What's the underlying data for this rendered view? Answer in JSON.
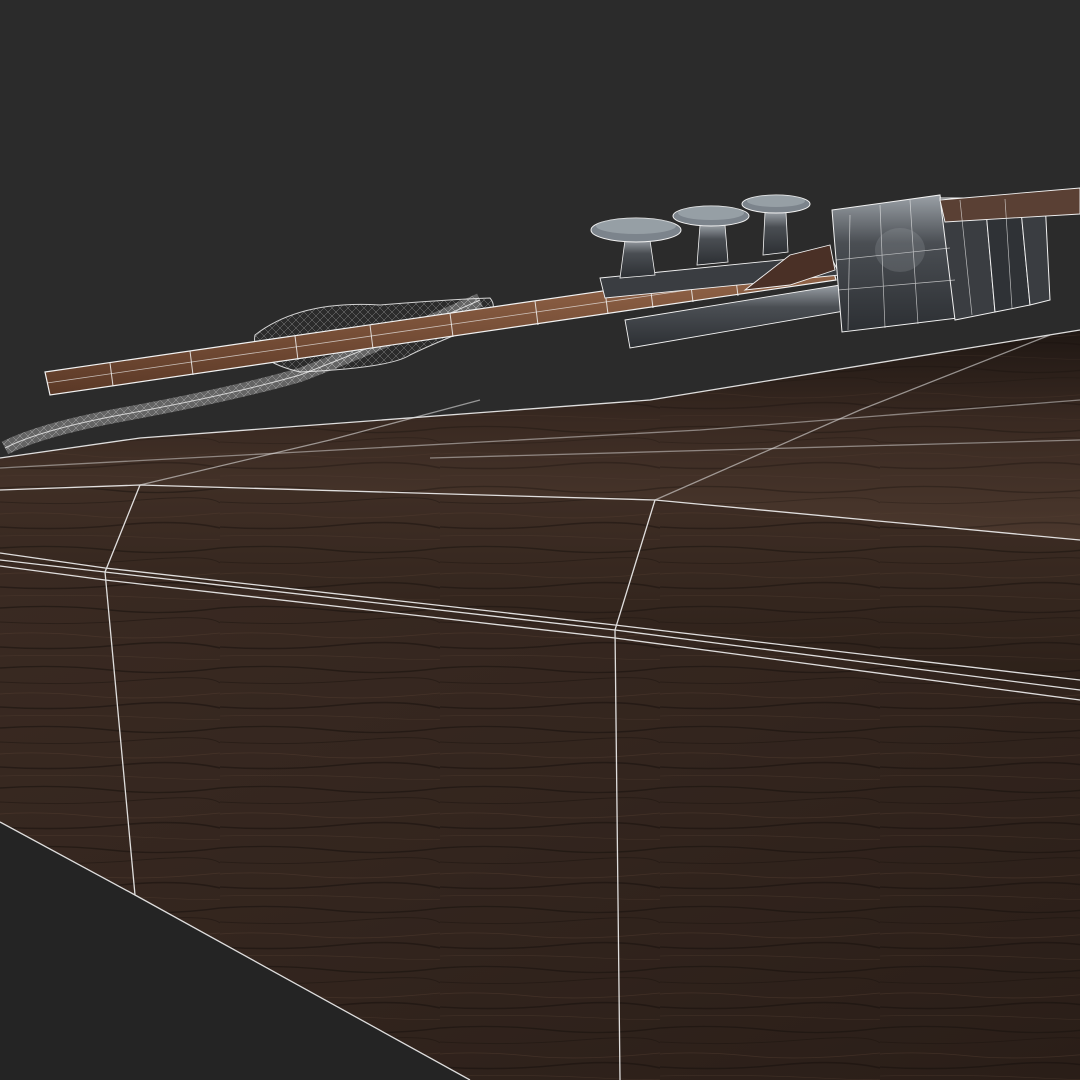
{
  "scene": {
    "kind": "3d-wireframe-render",
    "colors": {
      "background": "#2b2b2b",
      "wood_dark": "#2f221b",
      "wood_mid": "#4a372c",
      "wood_light": "#6b4d3b",
      "rod_wood": "#7a5038",
      "metal_dark": "#3b3e42",
      "metal_light": "#8d949b",
      "wire": "#f2f2f2"
    },
    "objects": [
      {
        "name": "wooden-deck-block",
        "material": "dark wood"
      },
      {
        "name": "wooden-rod",
        "material": "wood"
      },
      {
        "name": "rope-loop",
        "material": "rope"
      },
      {
        "name": "cleat-mount",
        "material": "metal"
      },
      {
        "name": "knob-post",
        "material": "metal",
        "count": 3
      },
      {
        "name": "cylinder-clamp",
        "material": "metal"
      }
    ]
  }
}
